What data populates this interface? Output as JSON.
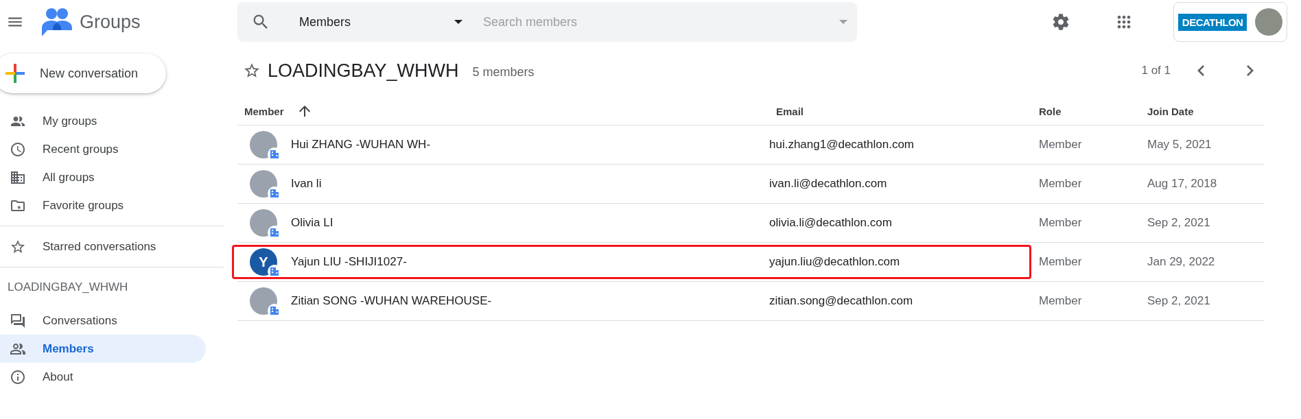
{
  "app": {
    "title": "Groups"
  },
  "search": {
    "scope": "Members",
    "placeholder": "Search members"
  },
  "account": {
    "brand_logo": "DECATHLON"
  },
  "new_button": "New conversation",
  "sidebar": {
    "nav": [
      {
        "label": "My groups",
        "selected": false
      },
      {
        "label": "Recent groups",
        "selected": false
      },
      {
        "label": "All groups",
        "selected": false
      },
      {
        "label": "Favorite groups",
        "selected": false
      }
    ],
    "starred": {
      "label": "Starred conversations",
      "selected": false
    },
    "group_name": "LOADINGBAY_WHWH",
    "group_items": [
      {
        "label": "Conversations",
        "selected": false
      },
      {
        "label": "Members",
        "selected": true
      },
      {
        "label": "About",
        "selected": false
      }
    ]
  },
  "group": {
    "title": "LOADINGBAY_WHWH",
    "starred": false,
    "member_count": "5 members"
  },
  "pagination": "1 of 1",
  "table": {
    "columns": [
      "Member",
      "Email",
      "Role",
      "Join Date"
    ],
    "rows": [
      {
        "name": "Hui ZHANG -WUHAN WH-",
        "email": "hui.zhang1@decathlon.com",
        "role": "Member",
        "join_date": "May 5, 2021",
        "avatar": {
          "kind": "photo"
        },
        "highlighted": false
      },
      {
        "name": "Ivan li",
        "email": "ivan.li@decathlon.com",
        "role": "Member",
        "join_date": "Aug 17, 2018",
        "avatar": {
          "kind": "photo"
        },
        "highlighted": false
      },
      {
        "name": "Olivia LI",
        "email": "olivia.li@decathlon.com",
        "role": "Member",
        "join_date": "Sep 2, 2021",
        "avatar": {
          "kind": "photo"
        },
        "highlighted": false
      },
      {
        "name": "Yajun LIU -SHIJI1027-",
        "email": "yajun.liu@decathlon.com",
        "role": "Member",
        "join_date": "Jan 29, 2022",
        "avatar": {
          "kind": "letter",
          "letter": "Y"
        },
        "highlighted": true
      },
      {
        "name": "Zitian SONG -WUHAN WAREHOUSE-",
        "email": "zitian.song@decathlon.com",
        "role": "Member",
        "join_date": "Sep 2, 2021",
        "avatar": {
          "kind": "photo"
        },
        "highlighted": false
      }
    ]
  }
}
